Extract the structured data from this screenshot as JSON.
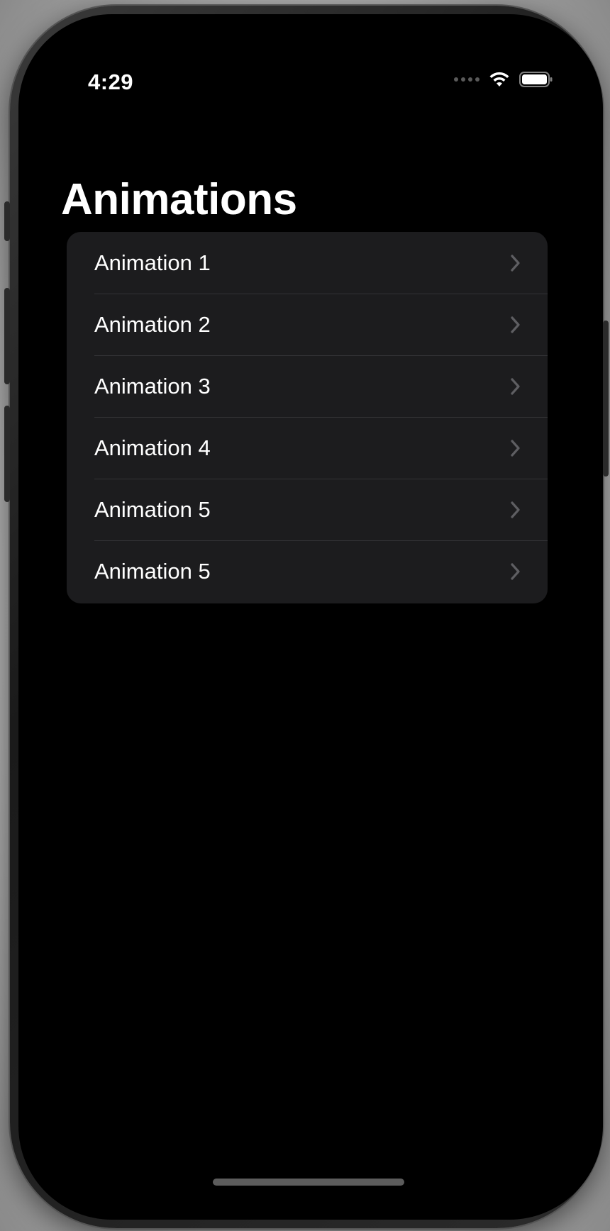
{
  "status_bar": {
    "time": "4:29"
  },
  "navigation": {
    "title": "Animations"
  },
  "list": {
    "items": [
      {
        "label": "Animation 1"
      },
      {
        "label": "Animation 2"
      },
      {
        "label": "Animation 3"
      },
      {
        "label": "Animation 4"
      },
      {
        "label": "Animation 5"
      },
      {
        "label": "Animation 5"
      }
    ]
  },
  "icons": {
    "wifi": "wifi-icon",
    "battery": "battery-icon",
    "cellular": "cellular-signal-icon",
    "chevron": "chevron-right-icon"
  },
  "colors": {
    "background": "#000000",
    "list_background": "#1c1c1e",
    "separator": "#333336",
    "text": "#ffffff",
    "chevron": "#5e5e62"
  }
}
